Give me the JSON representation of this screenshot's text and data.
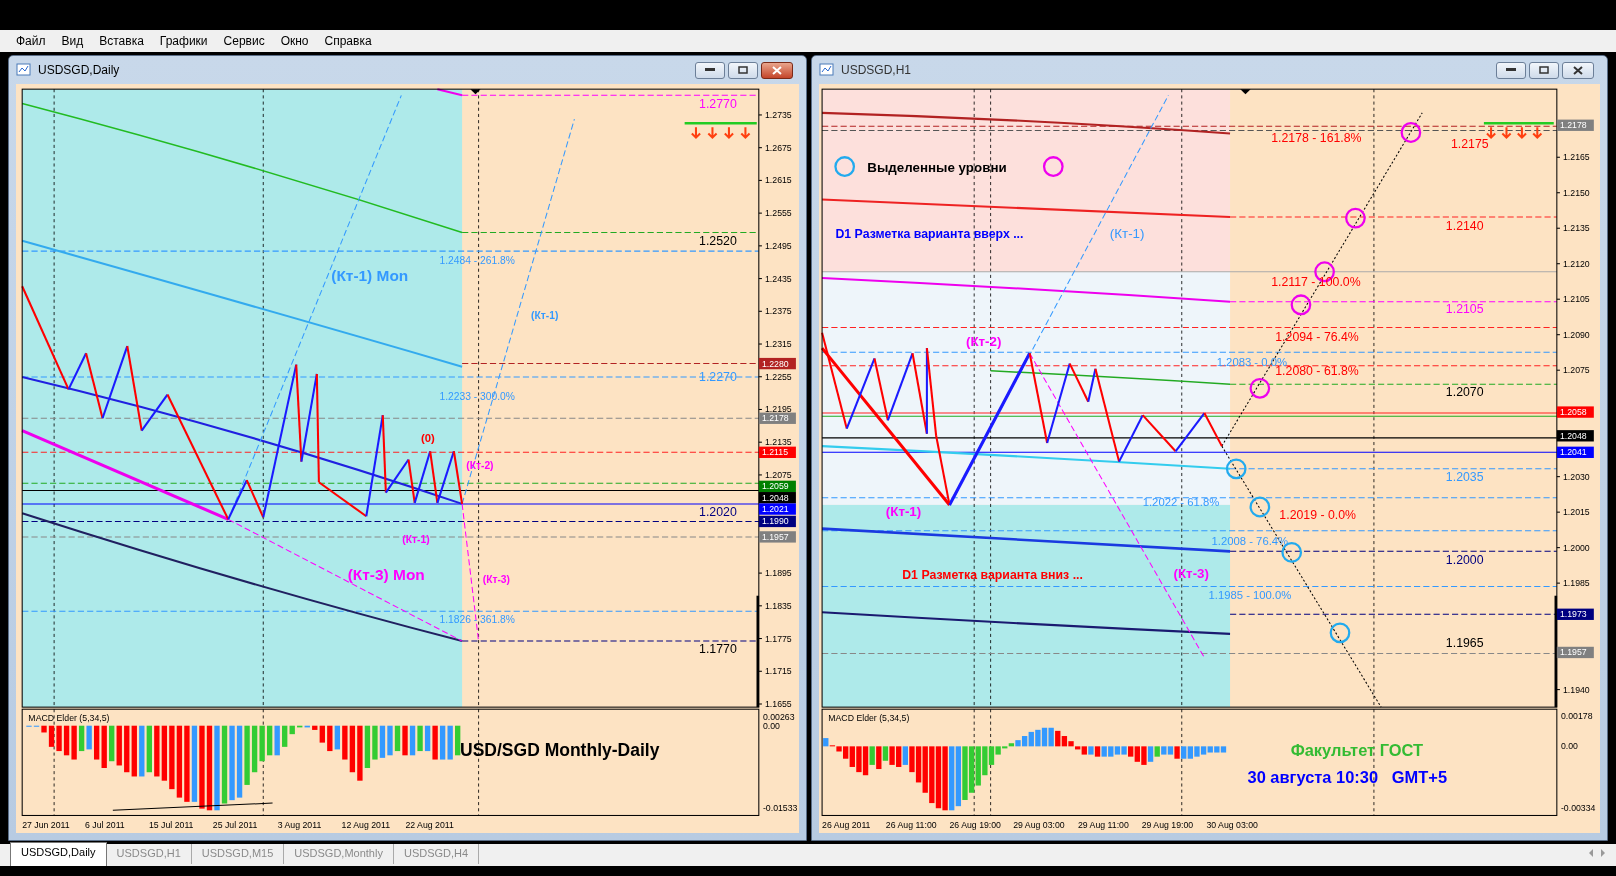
{
  "menu": [
    "Файл",
    "Вид",
    "Вставка",
    "Графики",
    "Сервис",
    "Окно",
    "Справка"
  ],
  "windows": [
    {
      "title": "USDSGD,Daily",
      "active": true,
      "chart": {
        "price_ticks": [
          "1.2735",
          "1.2675",
          "1.2615",
          "1.2555",
          "1.2495",
          "1.2435",
          "1.2375",
          "1.2315",
          "1.2255",
          "1.2195",
          "1.2135",
          "1.2075",
          "1.1895",
          "1.1835",
          "1.1775",
          "1.1715",
          "1.1655"
        ],
        "price_tags": [
          {
            "text": "1.2280",
            "color": "#b22222"
          },
          {
            "text": "1.2178",
            "color": "#808080"
          },
          {
            "text": "1.2115",
            "color": "#ff0000"
          },
          {
            "text": "1.2059",
            "color": "#008000"
          },
          {
            "text": "1.2048",
            "color": "#000000"
          },
          {
            "text": "1.2021",
            "color": "#0000ff"
          },
          {
            "text": "1.1990",
            "color": "#000080"
          },
          {
            "text": "1.1957",
            "color": "#808080"
          }
        ],
        "labels": [
          {
            "text": "(Кт-1) Mon",
            "color": "#3399ff"
          },
          {
            "text": "1.2484 - 261.8%",
            "color": "#3399ff"
          },
          {
            "text": "(Кт-1)",
            "color": "#3399ff"
          },
          {
            "text": "1.2233 - 300.0%",
            "color": "#3399ff"
          },
          {
            "text": "(0)",
            "color": "#ff0000"
          },
          {
            "text": "(Кт-2)",
            "color": "#ff00ff"
          },
          {
            "text": "(Кт-1)",
            "color": "#ff00ff"
          },
          {
            "text": "(Кт-3) Mon",
            "color": "#ff00ff"
          },
          {
            "text": "(Кт-3)",
            "color": "#ff00ff"
          },
          {
            "text": "1.1826 - 361.8%",
            "color": "#3399ff"
          },
          {
            "text": "1.2770",
            "color": "#ff00ff"
          },
          {
            "text": "1.2520",
            "color": "#000000"
          },
          {
            "text": "1.2270",
            "color": "#3399ff"
          },
          {
            "text": "1.2020",
            "color": "#000080"
          },
          {
            "text": "1.1770",
            "color": "#000000"
          }
        ],
        "indicator": {
          "name": "MACD Elder (5,34,5)",
          "ticks": [
            "0.00263",
            "0.00",
            "-0.01533"
          ]
        },
        "captions": [
          {
            "text": "USD/SGD Monthly-Daily",
            "color": "#000000"
          }
        ],
        "time_ticks": [
          "27 Jun 2011",
          "6 Jul 2011",
          "15 Jul 2011",
          "25 Jul 2011",
          "3 Aug 2011",
          "12 Aug 2011",
          "22 Aug 2011"
        ]
      }
    },
    {
      "title": "USDSGD,H1",
      "active": false,
      "chart": {
        "price_ticks": [
          "1.2165",
          "1.2150",
          "1.2135",
          "1.2120",
          "1.2105",
          "1.2090",
          "1.2075",
          "1.2030",
          "1.2015",
          "1.2000",
          "1.1985",
          "1.1940"
        ],
        "price_tags": [
          {
            "text": "1.2178",
            "color": "#808080"
          },
          {
            "text": "1.2058",
            "color": "#ff0000"
          },
          {
            "text": "1.2048",
            "color": "#000000"
          },
          {
            "text": "1.2041",
            "color": "#0000ff"
          },
          {
            "text": "1.1973",
            "color": "#000080"
          },
          {
            "text": "1.1957",
            "color": "#808080"
          }
        ],
        "labels": [
          {
            "text": "Выделенные уровни",
            "color": "#000000"
          },
          {
            "text": "D1 Разметка варианта вверх ...",
            "color": "#0000ff"
          },
          {
            "text": "(Кт-1)",
            "color": "#3399ff"
          },
          {
            "text": "1.2178 - 161.8%",
            "color": "#ff0000"
          },
          {
            "text": "1.2175",
            "color": "#ff0000"
          },
          {
            "text": "1.2140",
            "color": "#ff0000"
          },
          {
            "text": "1.2117 - 100.0%",
            "color": "#ff0000"
          },
          {
            "text": "1.2105",
            "color": "#ff00ff"
          },
          {
            "text": "(Кт-2)",
            "color": "#ff00ff"
          },
          {
            "text": "1.2094 - 76.4%",
            "color": "#ff0000"
          },
          {
            "text": "1.2083 - 0.0%",
            "color": "#3399ff"
          },
          {
            "text": "1.2080 - 61.8%",
            "color": "#ff0000"
          },
          {
            "text": "1.2070",
            "color": "#000000"
          },
          {
            "text": "1.2035",
            "color": "#3399ff"
          },
          {
            "text": "(Кт-1)",
            "color": "#ff00ff"
          },
          {
            "text": "1.2022 - 61.8%",
            "color": "#3399ff"
          },
          {
            "text": "1.2019 - 0.0%",
            "color": "#ff0000"
          },
          {
            "text": "1.2008 - 76.4%",
            "color": "#3399ff"
          },
          {
            "text": "1.2000",
            "color": "#000080"
          },
          {
            "text": "D1 Разметка варианта вниз ...",
            "color": "#ff0000"
          },
          {
            "text": "(Кт-3)",
            "color": "#ff00ff"
          },
          {
            "text": "1.1985 - 100.0%",
            "color": "#3399ff"
          },
          {
            "text": "1.1965",
            "color": "#000000"
          }
        ],
        "indicator": {
          "name": "MACD Elder (5,34,5)",
          "ticks": [
            "0.00178",
            "0.00",
            "-0.00334"
          ]
        },
        "captions": [
          {
            "text": "Факультет ГОСТ",
            "color": "#33bb33"
          },
          {
            "text": "30 августа 10:30   GMT+5",
            "color": "#0000ff"
          }
        ],
        "time_ticks": [
          "26 Aug 2011",
          "26 Aug 11:00",
          "26 Aug 19:00",
          "29 Aug 03:00",
          "29 Aug 11:00",
          "29 Aug 19:00",
          "30 Aug 03:00"
        ]
      }
    }
  ],
  "tabs": [
    {
      "label": "USDSGD,Daily",
      "selected": true
    },
    {
      "label": "USDSGD,H1",
      "selected": false
    },
    {
      "label": "USDSGD,M15",
      "selected": false
    },
    {
      "label": "USDSGD,Monthly",
      "selected": false
    },
    {
      "label": "USDSGD,H4",
      "selected": false
    }
  ]
}
